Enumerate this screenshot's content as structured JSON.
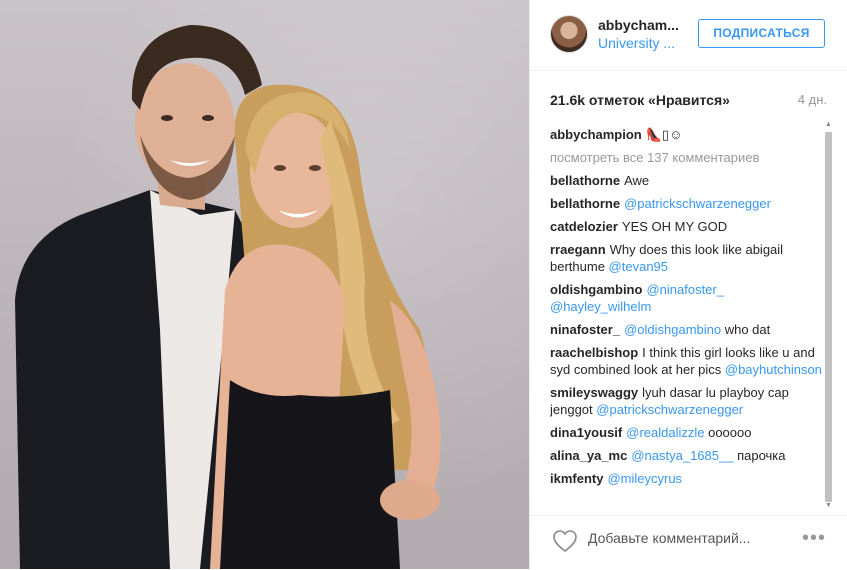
{
  "post": {
    "photo_alt": "",
    "author": "abbycham...",
    "location": "University ...",
    "follow_label": "ПОДПИСАТЬСЯ",
    "likes": "21.6k отметок «Нравится»",
    "age": "4 дн.",
    "caption_user": "abbychampion",
    "caption_text": "👠▯☺",
    "view_all": "посмотреть все 137 комментариев",
    "comments": [
      {
        "user": "bellathorne",
        "parts": [
          {
            "t": "Awe",
            "m": false
          }
        ]
      },
      {
        "user": "bellathorne",
        "parts": [
          {
            "t": "@patrickschwarzenegger",
            "m": true
          }
        ]
      },
      {
        "user": "catdelozier",
        "parts": [
          {
            "t": "YES OH MY GOD",
            "m": false
          }
        ]
      },
      {
        "user": "rraegann",
        "parts": [
          {
            "t": "Why does this look like abigail berthume ",
            "m": false
          },
          {
            "t": "@tevan95",
            "m": true
          }
        ]
      },
      {
        "user": "oldishgambino",
        "parts": [
          {
            "t": "@ninafoster_",
            "m": true
          },
          {
            "t": " ",
            "m": false
          },
          {
            "t": "@hayley_wilhelm",
            "m": true
          }
        ]
      },
      {
        "user": "ninafoster_",
        "parts": [
          {
            "t": "@oldishgambino",
            "m": true
          },
          {
            "t": " who dat",
            "m": false
          }
        ]
      },
      {
        "user": "raachelbishop",
        "parts": [
          {
            "t": "I think this girl looks like u and syd combined look at her pics ",
            "m": false
          },
          {
            "t": "@bayhutchinson",
            "m": true
          }
        ]
      },
      {
        "user": "smileyswaggy",
        "parts": [
          {
            "t": "lyuh dasar lu playboy cap jenggot ",
            "m": false
          },
          {
            "t": "@patrickschwarzenegger",
            "m": true
          }
        ]
      },
      {
        "user": "dina1yousif",
        "parts": [
          {
            "t": "@realdalizzle",
            "m": true
          },
          {
            "t": " oooooo",
            "m": false
          }
        ]
      },
      {
        "user": "alina_ya_mc",
        "parts": [
          {
            "t": "@nastya_1685__",
            "m": true
          },
          {
            "t": " парочка",
            "m": false
          }
        ]
      },
      {
        "user": "ikmfenty",
        "parts": [
          {
            "t": "@mileycyrus",
            "m": true
          }
        ]
      }
    ],
    "add_comment_placeholder": "Добавьте комментарий...",
    "more_label": "•••"
  },
  "icons": {
    "heart": "heart-icon",
    "more": "more-options-icon"
  },
  "colors": {
    "link": "#3897f0",
    "muted": "#999999",
    "border": "#efefef"
  }
}
